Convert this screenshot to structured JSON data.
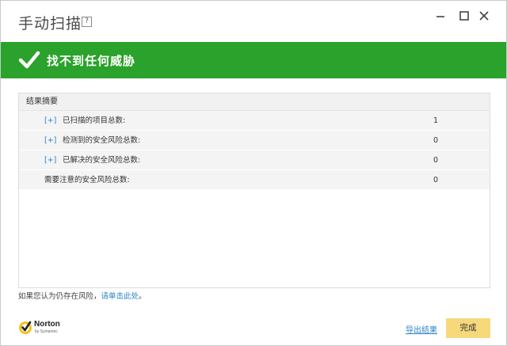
{
  "window": {
    "title": "手动扫描",
    "help_label": "?",
    "min_icon": "minimize-icon",
    "max_icon": "maximize-icon",
    "close_icon": "close-icon"
  },
  "banner": {
    "text": "找不到任何威胁",
    "icon": "checkmark-icon",
    "color": "#2aa22b"
  },
  "summary": {
    "header": "结果摘要",
    "rows": [
      {
        "expand": "[+]",
        "label": "已扫描的项目总数:",
        "value": "1"
      },
      {
        "expand": "[+]",
        "label": "检测到的安全风险总数:",
        "value": "0"
      },
      {
        "expand": "[+]",
        "label": "已解决的安全风险总数:",
        "value": "0"
      },
      {
        "expand": "",
        "label": "需要注意的安全风险总数:",
        "value": "0"
      }
    ]
  },
  "note": {
    "prefix": "如果您认为仍存在风险，",
    "link": "请单击此处",
    "suffix": "。"
  },
  "logo": {
    "name": "Norton",
    "sub": "by Symantec"
  },
  "footer": {
    "export_label": "导出结果",
    "done_label": "完成",
    "done_color": "#f7d97c"
  }
}
